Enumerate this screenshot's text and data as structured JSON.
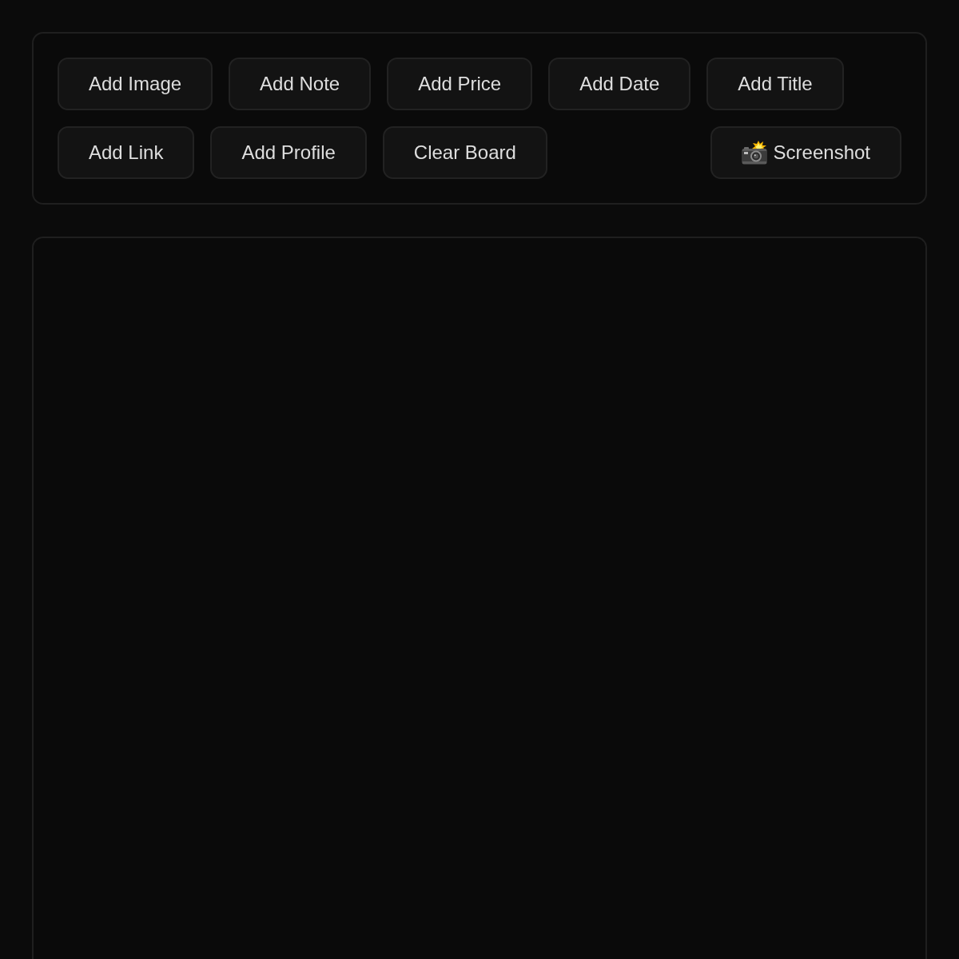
{
  "toolbar": {
    "rows": [
      {
        "buttons": [
          {
            "label": "Add Image",
            "kind": "action"
          },
          {
            "label": "Add Note",
            "kind": "action"
          },
          {
            "label": "Add Price",
            "kind": "action"
          },
          {
            "label": "Add Date",
            "kind": "action"
          },
          {
            "label": "Add Title",
            "kind": "action"
          }
        ]
      },
      {
        "buttons": [
          {
            "label": "Add Link",
            "kind": "action"
          },
          {
            "label": "Add Profile",
            "kind": "action"
          },
          {
            "label": "Clear Board",
            "kind": "action"
          },
          {
            "label": "Screenshot",
            "kind": "capture"
          }
        ]
      }
    ]
  }
}
